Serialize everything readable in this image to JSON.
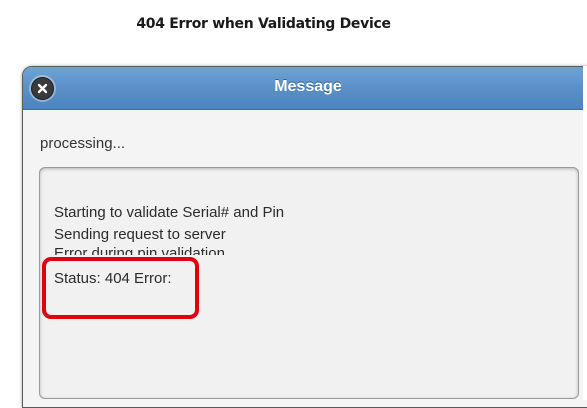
{
  "caption": "404 Error when Validating Device",
  "dialog": {
    "title": "Message",
    "close_icon": "close-circle-icon",
    "status": "processing...",
    "log_lines": [
      "Starting to validate Serial# and Pin",
      "Sending request to server",
      "Error during pin validation",
      "Status: 404 Error:"
    ]
  },
  "colors": {
    "titlebar": "#5a90c8",
    "highlight": "#e3000f"
  }
}
